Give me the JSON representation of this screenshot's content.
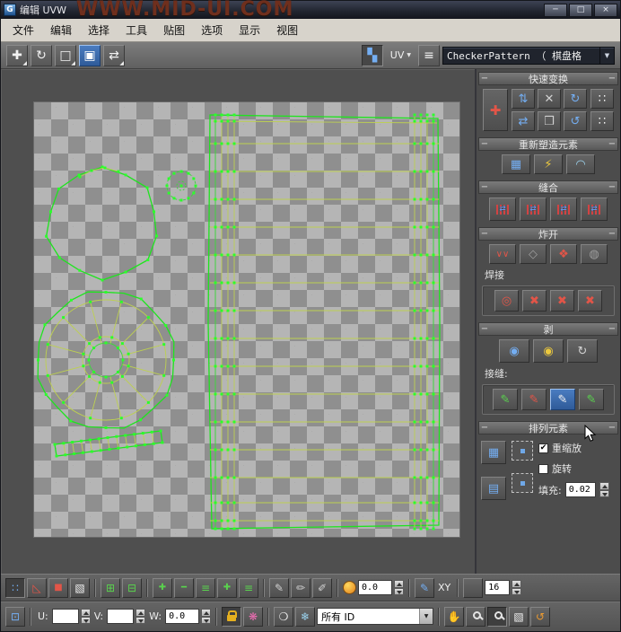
{
  "window": {
    "title": "编辑 UVW",
    "watermark": "WWW.MID-UI.COM"
  },
  "menubar": {
    "items": [
      "文件",
      "编辑",
      "选择",
      "工具",
      "贴图",
      "选项",
      "显示",
      "视图"
    ]
  },
  "toolbar": {
    "uv_channel": "UV",
    "texture_selector": "CheckerPattern （ 棋盘格"
  },
  "panel": {
    "quick_transform_title": "快速变换",
    "reshape_title": "重新塑造元素",
    "stitch_title": "缝合",
    "explode_title": "炸开",
    "weld_label": "焊接",
    "peel_title": "剥",
    "seams_label": "接缝:",
    "arrange_title": "排列元素",
    "rescale_label": "重缩放",
    "rotate_label": "旋转",
    "padding_label": "填充:",
    "padding_value": "0.02"
  },
  "statusbar": {
    "falloff_value": "0.0",
    "xy_label": "XY",
    "grid_value": "16",
    "u_label": "U:",
    "v_label": "V:",
    "w_label": "W:",
    "u_value": "",
    "v_value": "",
    "w_value": "0.0",
    "id_filter_value": "所有 ID"
  },
  "colors": {
    "accent_blue": "#2f5b99",
    "wire_green": "#1fe31f",
    "wire_inner": "#bdd051",
    "watermark": "#6f2f1d"
  },
  "icons": {
    "rollout-dash": "−",
    "app-icon": "G",
    "minimize-icon": "─",
    "maximize-icon": "□",
    "close-icon": "×",
    "flyout-icon": "◢",
    "dropdown-icon": "▼",
    "move-icon": "✚",
    "rotate-icon": "↻",
    "scale-icon": "□",
    "freeform-icon": "▣",
    "mirror-icon": "⇄",
    "showmap-icon": "▚",
    "list-icon": "≡",
    "qt-move-icon": "✚",
    "qt-alignv-icon": "⇅",
    "qt-cross-icon": "✕",
    "qt-rotcw-icon": "↻",
    "qt-alignh-icon": "⇄",
    "qt-box-icon": "❒",
    "qt-rotccw-icon": "↺",
    "qt-link-icon": "∷",
    "reshape-grid-icon": "▦",
    "reshape-bolt-icon": "⚡",
    "reshape-arch-icon": "◠",
    "stitch-arrow-icon": "⇄",
    "explode-flatten-icon": "∨∨",
    "explode-poly-icon": "◇",
    "explode-break-icon": "❖",
    "explode-sphere-icon": "◍",
    "weld-target-icon": "◎",
    "weld-x-icon": "✖",
    "peel-quick-icon": "◉",
    "peel-mode-icon": "◉",
    "peel-reset-icon": "↻",
    "seam-pencil-icon": "✎",
    "pack-icon": "▦",
    "pack2-icon": "▤",
    "check-icon": "✔",
    "vertex-icon": "∷",
    "edge-icon": "◺",
    "face-icon": "■",
    "element-icon": "▧",
    "grow-icon": "⊞",
    "shrink-icon": "⊟",
    "plus-icon": "✚",
    "minus-icon": "━",
    "loop-icon": "≡",
    "pencil-icon": "✎",
    "brush1-icon": "✏",
    "brush2-icon": "✐",
    "absolute-icon": "⊡",
    "filter-icon": "❋",
    "bulb-icon": "❍",
    "freeze-icon": "❄",
    "pan-icon": "✋",
    "cube-icon": "▧",
    "zoomext-icon": "↺"
  }
}
